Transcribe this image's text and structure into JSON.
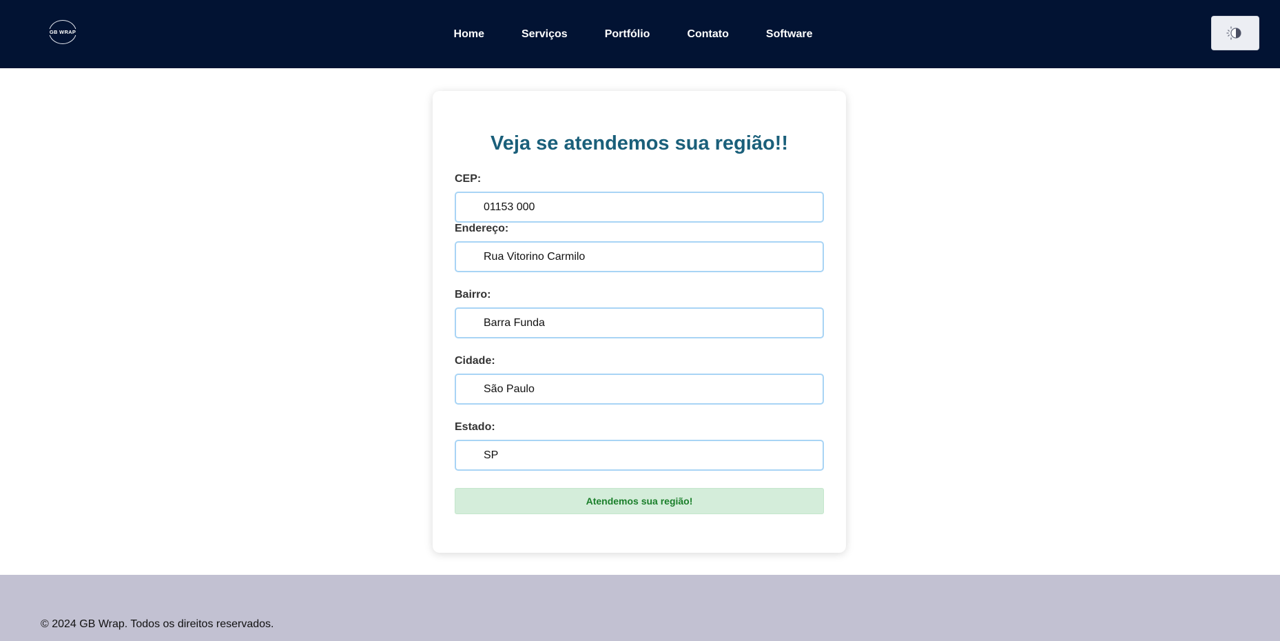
{
  "brand": {
    "logo_text": "GB WRAP"
  },
  "nav": {
    "items": [
      {
        "label": "Home"
      },
      {
        "label": "Serviços"
      },
      {
        "label": "Portfólio"
      },
      {
        "label": "Contato"
      },
      {
        "label": "Software"
      }
    ],
    "theme_toggle_icon": "theme-toggle-icon"
  },
  "form": {
    "title": "Veja se atendemos sua região!!",
    "fields": [
      {
        "label": "CEP:",
        "value": "01153 000"
      },
      {
        "label": "Endereço:",
        "value": "Rua Vitorino Carmilo"
      },
      {
        "label": "Bairro:",
        "value": "Barra Funda"
      },
      {
        "label": "Cidade:",
        "value": "São Paulo"
      },
      {
        "label": "Estado:",
        "value": "SP"
      }
    ],
    "status_message": "Atendemos sua região!"
  },
  "footer": {
    "text": "© 2024 GB Wrap. Todos os direitos reservados."
  },
  "colors": {
    "navbar": "#021333",
    "title": "#1a5f7a",
    "input_border": "#a8d4f5",
    "success_bg": "#d4edda",
    "success_text": "#1a7f2a",
    "footer": "#c2c1d2"
  }
}
